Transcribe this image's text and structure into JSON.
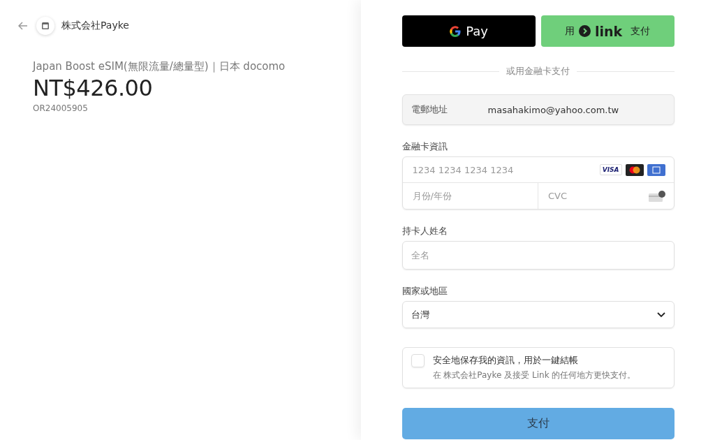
{
  "merchant": {
    "name": "株式会社Payke"
  },
  "order": {
    "product": "Japan Boost eSIM(無限流量/總量型)｜日本 docomo",
    "price": "NT$426.00",
    "order_id": "OR24005905"
  },
  "express": {
    "gpay_label": "Pay",
    "link_prefix": "用",
    "link_brand": "link",
    "link_suffix": "支付"
  },
  "divider_text": "或用金融卡支付",
  "email": {
    "label": "電郵地址",
    "value": "masahakimo@yahoo.com.tw"
  },
  "card": {
    "label": "金融卡資訊",
    "number_placeholder": "1234 1234 1234 1234",
    "visa_text": "VISA",
    "expiry_placeholder": "月份/年份",
    "cvc_placeholder": "CVC"
  },
  "cardholder": {
    "label": "持卡人姓名",
    "placeholder": "全名"
  },
  "country": {
    "label": "國家或地區",
    "value": "台灣"
  },
  "save_info": {
    "checked": false,
    "title": "安全地保存我的資訊，用於一鍵結帳",
    "description": "在 株式会社Payke 及接受 Link 的任何地方更快支付。"
  },
  "pay_button": {
    "label": "支付",
    "disabled": true
  }
}
